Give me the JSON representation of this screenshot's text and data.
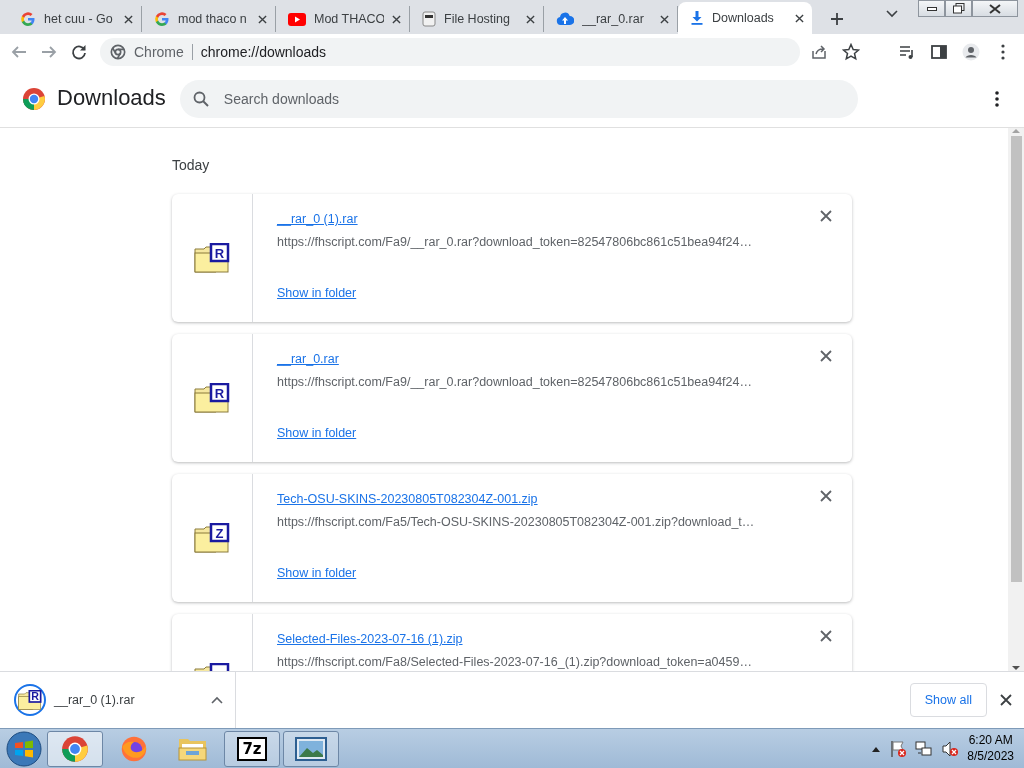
{
  "tabs": [
    {
      "kind": "google",
      "title": "het cuu - Go",
      "selected": false
    },
    {
      "kind": "google",
      "title": "mod thaco n",
      "selected": false
    },
    {
      "kind": "youtube",
      "title": "Mod THACO",
      "selected": false
    },
    {
      "kind": "page",
      "title": "File Hosting",
      "selected": false
    },
    {
      "kind": "cloud",
      "title": "__rar_0.rar",
      "selected": false
    },
    {
      "kind": "download",
      "title": "Downloads",
      "selected": true
    }
  ],
  "address_bar": {
    "chip": "Chrome",
    "url": "chrome://downloads"
  },
  "page": {
    "title": "Downloads",
    "search": {
      "placeholder": "Search downloads"
    },
    "section": "Today",
    "downloads": [
      {
        "file_name": "__rar_0 (1).rar",
        "type_letter": "R",
        "url": "https://fhscript.com/Fa9/__rar_0.rar?download_token=82547806bc861c51bea94f24…",
        "action": "Show in folder"
      },
      {
        "file_name": "__rar_0.rar",
        "type_letter": "R",
        "url": "https://fhscript.com/Fa9/__rar_0.rar?download_token=82547806bc861c51bea94f24…",
        "action": "Show in folder"
      },
      {
        "file_name": "Tech-OSU-SKINS-20230805T082304Z-001.zip",
        "type_letter": "Z",
        "url": "https://fhscript.com/Fa5/Tech-OSU-SKINS-20230805T082304Z-001.zip?download_t…",
        "action": "Show in folder"
      },
      {
        "file_name": "Selected-Files-2023-07-16 (1).zip",
        "url": "https://fhscript.com/Fa8/Selected-Files-2023-07-16_(1).zip?download_token=a0459…"
      }
    ]
  },
  "download_shelf": {
    "items": [
      {
        "file_name": "__rar_0 (1).rar",
        "type_letter": "R"
      }
    ],
    "show_all": "Show all"
  },
  "taskbar": {
    "apps": [
      {
        "kind": "chrome",
        "running": true,
        "selected": true
      },
      {
        "kind": "firefox",
        "running": false,
        "selected": false
      },
      {
        "kind": "explorer",
        "running": false,
        "selected": false
      },
      {
        "kind": "sevenzip",
        "label": "7z",
        "running": true,
        "selected": false
      },
      {
        "kind": "photos",
        "running": true,
        "selected": false
      }
    ],
    "clock": {
      "time": "6:20 AM",
      "date": "8/5/2023"
    }
  }
}
